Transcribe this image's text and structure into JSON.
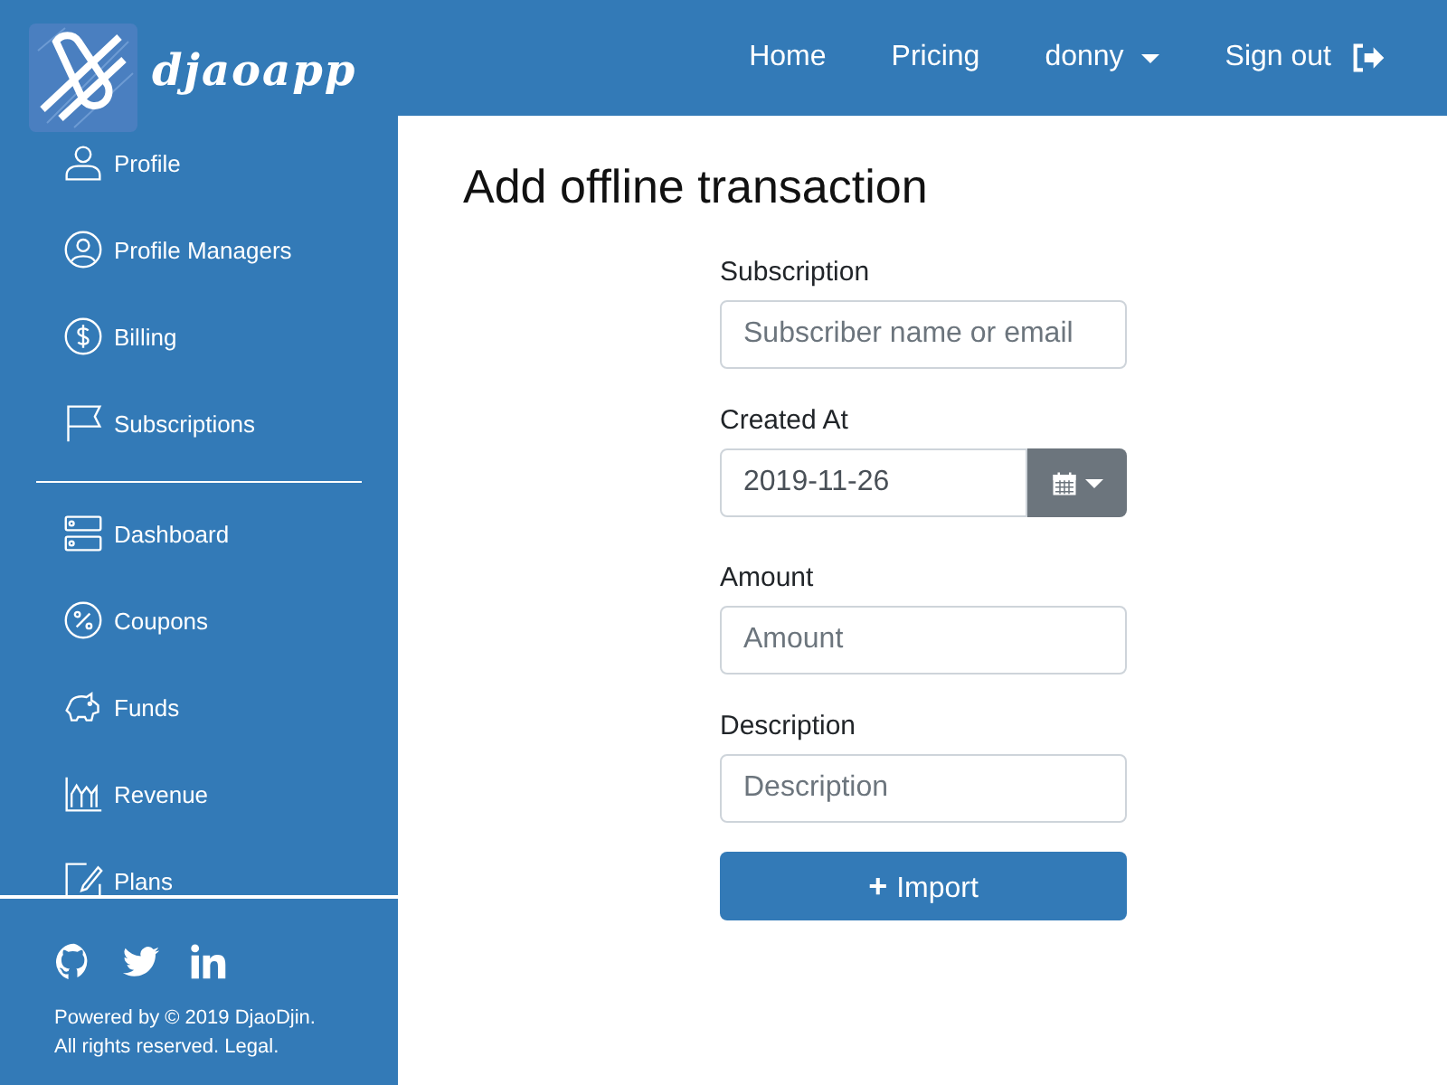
{
  "brand": {
    "name": "djaoapp"
  },
  "nav": [
    {
      "label": "Home",
      "kind": "link"
    },
    {
      "label": "Pricing",
      "kind": "link"
    },
    {
      "label": "donny",
      "kind": "dropdown"
    },
    {
      "label": "Sign out",
      "kind": "signout"
    }
  ],
  "sidebar": {
    "groups": [
      [
        {
          "label": "Profile"
        },
        {
          "label": "Profile Managers"
        },
        {
          "label": "Billing"
        },
        {
          "label": "Subscriptions"
        }
      ],
      [
        {
          "label": "Dashboard"
        },
        {
          "label": "Coupons"
        },
        {
          "label": "Funds"
        },
        {
          "label": "Revenue"
        },
        {
          "label": "Plans"
        }
      ]
    ],
    "footer_text": "Powered by © 2019 DjaoDjin. All rights reserved.",
    "footer_link": "Legal."
  },
  "page": {
    "title": "Add offline transaction",
    "fields": [
      {
        "label": "Subscription",
        "kind": "text",
        "placeholder": "Subscriber name or email"
      },
      {
        "label": "Created At",
        "kind": "date",
        "value": "2019-11-26"
      },
      {
        "label": "Amount",
        "kind": "text",
        "placeholder": "Amount"
      },
      {
        "label": "Description",
        "kind": "text",
        "placeholder": "Description"
      }
    ],
    "submit": {
      "icon": "+",
      "label": "Import"
    }
  }
}
